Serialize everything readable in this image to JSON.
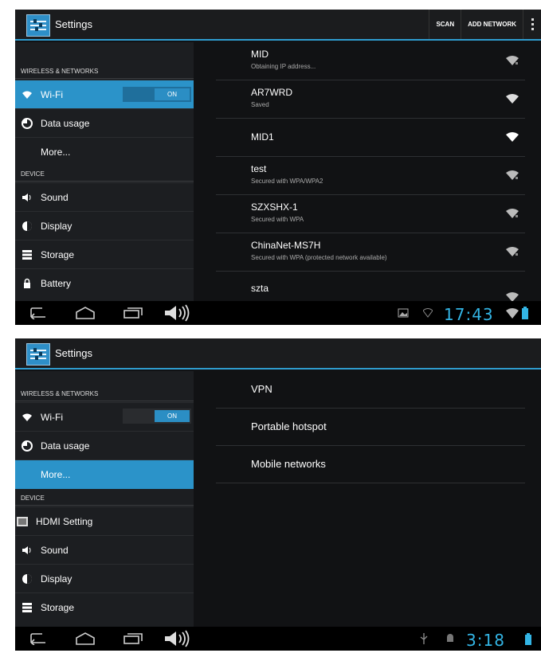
{
  "screen1": {
    "app_title": "Settings",
    "actions": {
      "scan": "SCAN",
      "add_network": "ADD NETWORK"
    },
    "sidebar": {
      "header_wireless": "WIRELESS & NETWORKS",
      "wifi": "Wi-Fi",
      "wifi_toggle": "ON",
      "data_usage": "Data usage",
      "more": "More...",
      "header_device": "DEVICE",
      "sound": "Sound",
      "display": "Display",
      "storage": "Storage",
      "battery": "Battery"
    },
    "networks": [
      {
        "name": "MID",
        "status": "Obtaining IP address..."
      },
      {
        "name": "AR7WRD",
        "status": "Saved"
      },
      {
        "name": "MID1",
        "status": ""
      },
      {
        "name": "test",
        "status": "Secured with WPA/WPA2"
      },
      {
        "name": "SZXSHX-1",
        "status": "Secured with WPA"
      },
      {
        "name": "ChinaNet-MS7H",
        "status": "Secured with WPA (protected network available)"
      },
      {
        "name": "szta",
        "status": ""
      }
    ],
    "clock": "17:43"
  },
  "screen2": {
    "app_title": "Settings",
    "sidebar": {
      "header_wireless": "WIRELESS & NETWORKS",
      "wifi": "Wi-Fi",
      "wifi_toggle": "ON",
      "data_usage": "Data usage",
      "more": "More...",
      "header_device": "DEVICE",
      "hdmi": "HDMI Setting",
      "sound": "Sound",
      "display": "Display",
      "storage": "Storage"
    },
    "more_items": [
      "VPN",
      "Portable hotspot",
      "Mobile networks"
    ],
    "clock": "3:18"
  },
  "colors": {
    "accent": "#33b5e5",
    "selected": "#2b93c9",
    "background": "#111214"
  }
}
